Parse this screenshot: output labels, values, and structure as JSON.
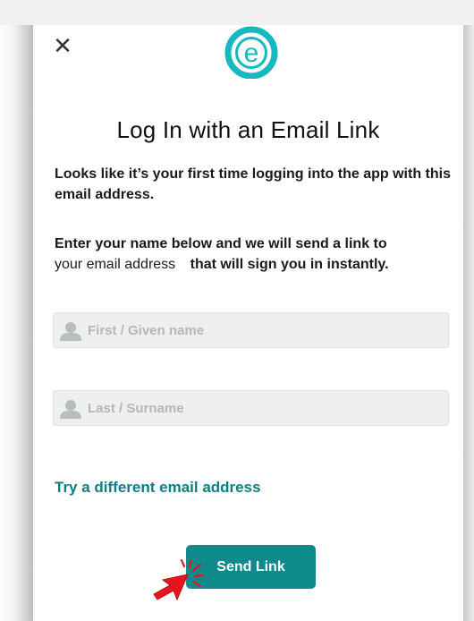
{
  "header": {
    "close_glyph": "✕",
    "logo_letter": "e"
  },
  "page": {
    "title": "Log In with an Email Link",
    "intro_text": "Looks like it’s your first time logging into the app with this email address.",
    "instruction_before": "Enter your name below and we will send a link to",
    "instruction_email": "your email address",
    "instruction_after": "that will sign you in instantly."
  },
  "form": {
    "first_name_placeholder": "First / Given name",
    "first_name_value": "",
    "last_name_placeholder": "Last / Surname",
    "last_name_value": ""
  },
  "actions": {
    "alt_email_link": "Try a different email address",
    "send_button": "Send Link"
  },
  "colors": {
    "accent": "#0e8a8d",
    "logo_teal": "#17b8c0",
    "link": "#0c7f84",
    "pointer": "#e8141c"
  },
  "icons": {
    "close": "close-icon",
    "user": "user-icon",
    "pointer": "click-pointer-icon"
  }
}
